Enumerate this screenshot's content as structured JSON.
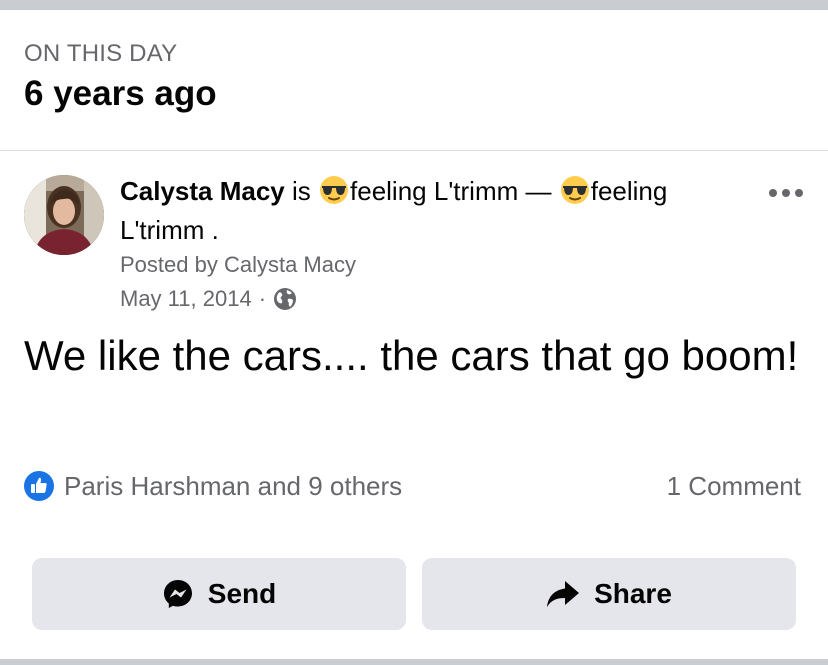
{
  "memory": {
    "label": "ON THIS DAY",
    "title": "6 years ago"
  },
  "post": {
    "author": "Calysta Macy",
    "header": {
      "is_word": "is",
      "feeling_1": "feeling L'trimm —",
      "feeling_2": "feeling L'trimm ."
    },
    "feeling_emoji": "smiling-face-with-sunglasses",
    "posted_by": "Posted by Calysta Macy",
    "date": "May 11, 2014",
    "separator": "·",
    "audience_icon": "globe-icon",
    "body": "We like the cars.... the cars that go boom!"
  },
  "engagement": {
    "reactions_text": "Paris Harshman and 9 others",
    "comments_text": "1 Comment"
  },
  "actions": {
    "send_label": "Send",
    "share_label": "Share"
  },
  "colors": {
    "like_blue": "#1b74e4",
    "button_bg": "#e4e6eb",
    "secondary_text": "#65676b",
    "emoji_yellow": "#ffcc4d"
  }
}
